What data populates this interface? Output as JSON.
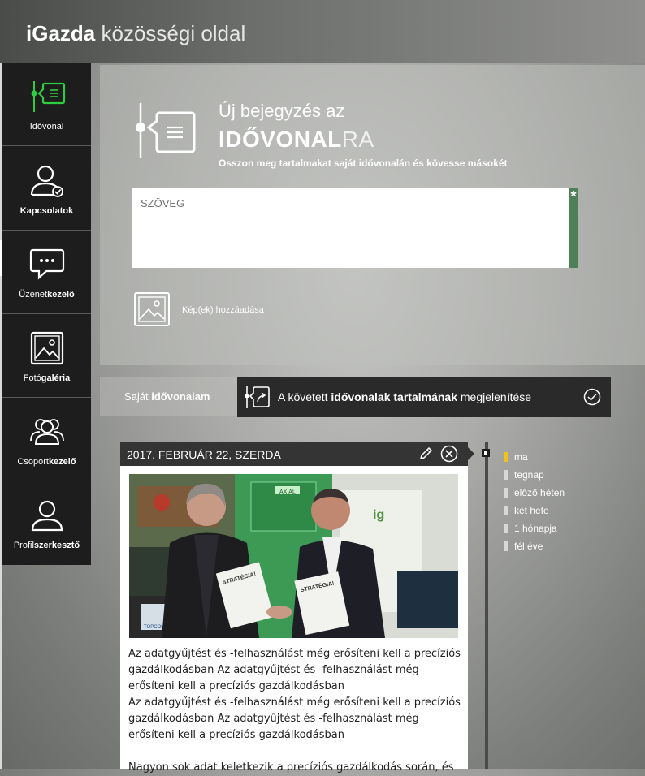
{
  "header": {
    "brand_bold": "iGazda",
    "brand_light": "közösségi oldal"
  },
  "sidebar": {
    "items": [
      {
        "label_a": "Idővonal",
        "label_b": ""
      },
      {
        "label_a": "",
        "label_b": "Kapcsolatok"
      },
      {
        "label_a": "Üzenet",
        "label_b": "kezelő"
      },
      {
        "label_a": "Fotó",
        "label_b": "galéria"
      },
      {
        "label_a": "Csoport",
        "label_b": "kezelő"
      },
      {
        "label_a": "Profil",
        "label_b": "szerkesztő"
      }
    ]
  },
  "composer": {
    "title_line1": "Új bejegyzés az",
    "title_bold": "IDŐVONAL",
    "title_light": "RA",
    "subtitle": "Osszon meg tartalmakat saját idővonalán és kövesse másokét",
    "text_placeholder": "SZÖVEG",
    "required_mark": "*",
    "add_image_label": "Kép(ek) hozzáadása"
  },
  "tabs": {
    "own_a": "Saját ",
    "own_b": "idővonalam",
    "follow_a": "A követett ",
    "follow_b": "idővonalak tartalmának",
    "follow_c": " megjelenítése"
  },
  "filters": [
    "ma",
    "tegnap",
    "előző héten",
    "két hete",
    "1 hónapja",
    "fél éve"
  ],
  "post": {
    "date": "2017. FEBRUÁR 22, SZERDA",
    "paragraph1": "Az adatgyűjtést és -felhasználást még erősíteni kell a precíziós gazdálkodásban Az adatgyűjtést és -felhasználást még erősíteni kell a precíziós gazdálkodásban",
    "paragraph2": "Az adatgyűjtést és -felhasználást még erősíteni kell a precíziós gazdálkodásban Az adatgyűjtést és -felhasználást még erősíteni kell a precíziós gazdálkodásban",
    "paragraph3": "Nagyon sok adat keletkezik a precíziós gazdálkodás során, és",
    "photo_texts": {
      "doc": "STRATÉGIA!",
      "sign": "AXIAL",
      "logo": "ig",
      "brand": "TOPCON"
    }
  },
  "colors": {
    "accent_green": "#2ecc40",
    "required_green": "#4f7f57",
    "filter_active": "#f2c21a"
  }
}
